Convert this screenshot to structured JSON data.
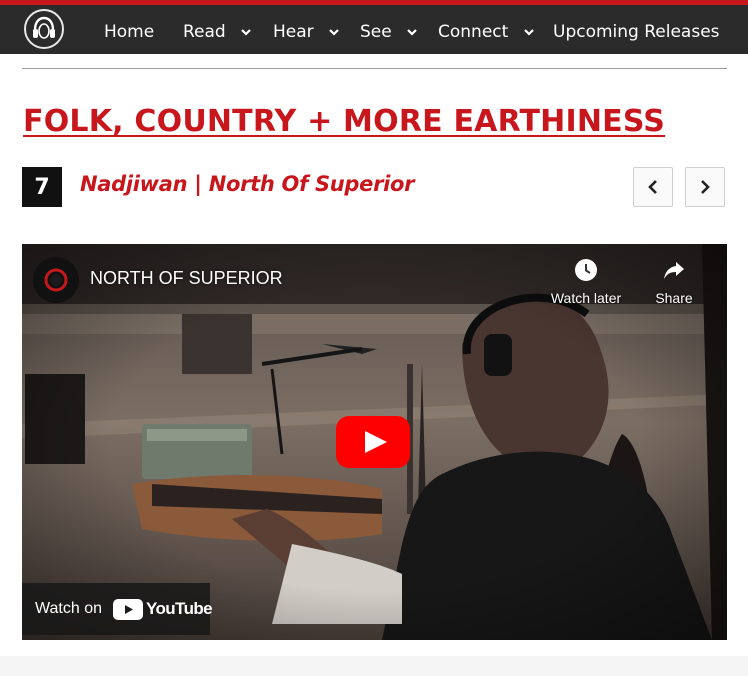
{
  "nav": {
    "items": [
      {
        "label": "Home",
        "has_dropdown": false
      },
      {
        "label": "Read",
        "has_dropdown": true
      },
      {
        "label": "Hear",
        "has_dropdown": true
      },
      {
        "label": "See",
        "has_dropdown": true
      },
      {
        "label": "Connect",
        "has_dropdown": true
      },
      {
        "label": "Upcoming Releases",
        "has_dropdown": false
      }
    ]
  },
  "section": {
    "title": "FOLK, COUNTRY + MORE EARTHINESS"
  },
  "entry": {
    "rank": "7",
    "title": "Nadjiwan | North Of Superior"
  },
  "video": {
    "title": "NORTH OF SUPERIOR",
    "watch_later_label": "Watch later",
    "share_label": "Share",
    "watch_on_label": "Watch on",
    "youtube_wordmark": "YouTube"
  },
  "colors": {
    "accent": "#c8161d",
    "topbar": "#2b2b2b",
    "youtube_red": "#ff0000"
  },
  "icons": {
    "logo": "headphones-face-logo",
    "dropdown": "chevron-down-icon",
    "prev": "chevron-left-icon",
    "next": "chevron-right-icon",
    "watch_later": "clock-icon",
    "share": "share-arrow-icon",
    "play": "play-icon"
  }
}
